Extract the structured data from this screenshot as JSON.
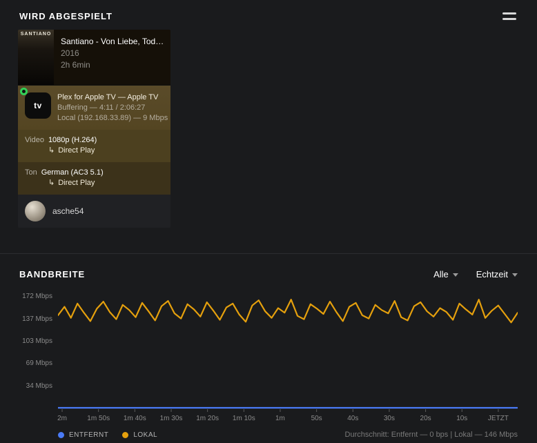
{
  "header": {
    "title": "WIRD ABGESPIELT"
  },
  "icons": {
    "direct_play_arrow": "↳"
  },
  "now_playing": {
    "poster_text": "SANTIANO",
    "title": "Santiano - Von Liebe, Tod…",
    "year": "2016",
    "duration": "2h 6min",
    "player": {
      "device_icon_text": "tv",
      "name": "Plex for Apple TV — Apple TV",
      "status": "Buffering — 4:11 / 2:06:27",
      "connection": "Local (192.168.33.89) — 9 Mbps"
    },
    "video": {
      "label": "Video",
      "value": "1080p (H.264)",
      "transcode": "Direct Play"
    },
    "audio": {
      "label": "Ton",
      "value": "German (AC3 5.1)",
      "transcode": "Direct Play"
    },
    "user": {
      "name": "asche54"
    }
  },
  "bandwidth": {
    "title": "BANDBREITE",
    "filters": [
      {
        "label": "Alle"
      },
      {
        "label": "Echtzeit"
      }
    ],
    "legend": [
      {
        "label": "ENTFERNT",
        "color": "#4a7bf7"
      },
      {
        "label": "LOKAL",
        "color": "#e5a00d"
      }
    ],
    "summary": "Durchschnitt: Entfernt — 0 bps | Lokal — 146 Mbps"
  },
  "chart_data": {
    "type": "line",
    "title": "BANDBREITE",
    "xlabel": "",
    "ylabel": "Mbps",
    "ylim": [
      0,
      180
    ],
    "grid": false,
    "legend_position": "bottom-left",
    "categories": [
      "2m",
      "1m 50s",
      "1m 40s",
      "1m 30s",
      "1m 20s",
      "1m 10s",
      "1m",
      "50s",
      "40s",
      "30s",
      "20s",
      "10s",
      "JETZT"
    ],
    "yticks": [
      {
        "value": 172,
        "label": "172 Mbps"
      },
      {
        "value": 137,
        "label": "137 Mbps"
      },
      {
        "value": 103,
        "label": "103 Mbps"
      },
      {
        "value": 69,
        "label": "69 Mbps"
      },
      {
        "value": 34,
        "label": "34 Mbps"
      }
    ],
    "series": [
      {
        "name": "ENTFERNT",
        "color": "#4a7bf7",
        "values": [
          0,
          0,
          0,
          0,
          0,
          0,
          0,
          0,
          0,
          0,
          0,
          0,
          0
        ]
      },
      {
        "name": "LOKAL",
        "color": "#e5a00d",
        "values": [
          142,
          155,
          138,
          160,
          146,
          133,
          152,
          163,
          147,
          136,
          158,
          150,
          139,
          161,
          148,
          134,
          156,
          164,
          145,
          137,
          159,
          151,
          140,
          162,
          149,
          135,
          154,
          160,
          143,
          132,
          157,
          165,
          148,
          138,
          153,
          146,
          166,
          141,
          136,
          159,
          152,
          144,
          163,
          147,
          133,
          155,
          161,
          142,
          137,
          158,
          150,
          145,
          164,
          139,
          134,
          156,
          162,
          148,
          140,
          153,
          147,
          135,
          160,
          151,
          143,
          166,
          138,
          149,
          157,
          144,
          131,
          146
        ]
      }
    ]
  }
}
